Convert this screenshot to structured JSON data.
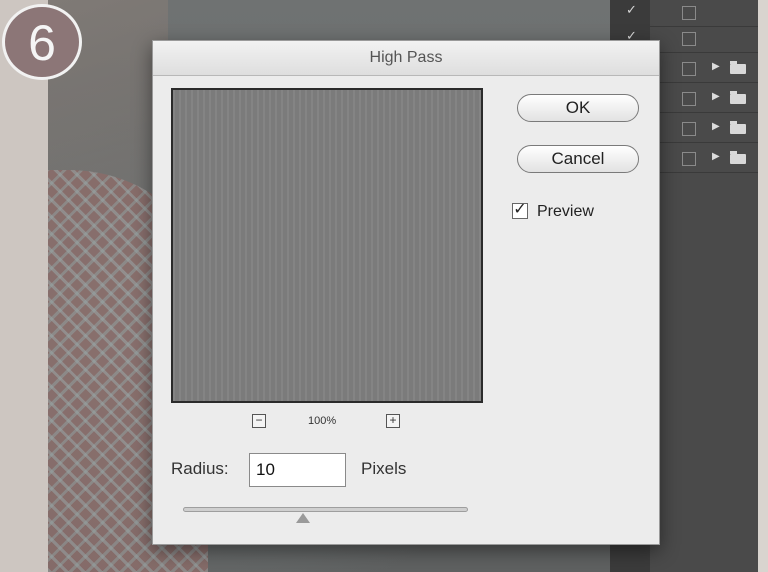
{
  "badge": {
    "step": "6"
  },
  "dialog": {
    "title": "High Pass",
    "zoom": {
      "minus": "−",
      "level": "100%",
      "plus": "+"
    },
    "ok_label": "OK",
    "cancel_label": "Cancel",
    "preview": {
      "checked": true,
      "check_glyph": "✓",
      "label": "Preview"
    },
    "radius": {
      "label": "Radius:",
      "value": "10",
      "unit": "Pixels",
      "slider_fraction": 0.42
    }
  },
  "layers_panel": {
    "rows": [
      {
        "visible_glyph": "✓"
      },
      {
        "visible_glyph": "✓"
      },
      {
        "visible_glyph": ""
      },
      {
        "visible_glyph": ""
      },
      {
        "visible_glyph": ""
      },
      {
        "visible_glyph": ""
      }
    ]
  }
}
